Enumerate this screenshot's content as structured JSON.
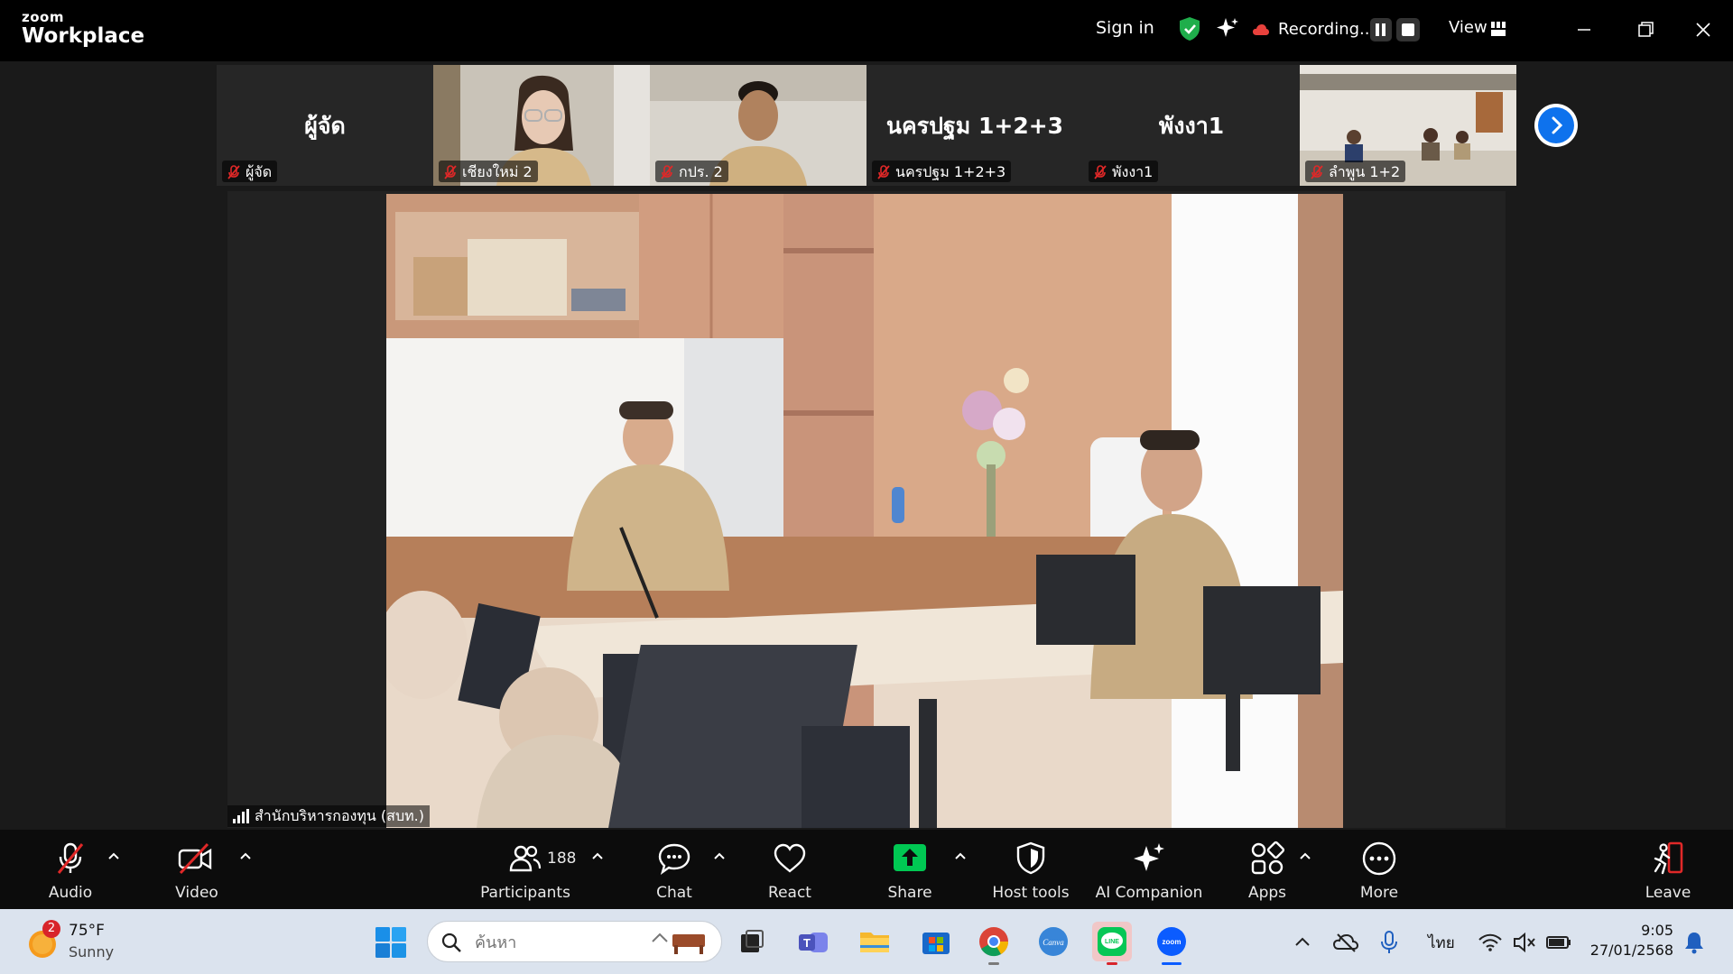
{
  "app": {
    "brand_small": "zoom",
    "brand_large": "Workplace"
  },
  "titlebar": {
    "sign_in": "Sign in",
    "recording_label": "Recording...",
    "view_label": "View"
  },
  "gallery": {
    "tiles": [
      {
        "big": "ผู้จัด",
        "label": "ผู้จัด"
      },
      {
        "big": "",
        "label": "เชียงใหม่ 2"
      },
      {
        "big": "",
        "label": "กปร. 2"
      },
      {
        "big": "นครปฐม 1+2+3",
        "label": "นครปฐม 1+2+3"
      },
      {
        "big": "พังงา1",
        "label": "พังงา1"
      },
      {
        "big": "",
        "label": "ลำพูน 1+2"
      }
    ]
  },
  "main_video": {
    "speaker": "สำนักบริหารกองทุน (สบท.)"
  },
  "toolbar": {
    "audio": "Audio",
    "video": "Video",
    "participants": "Participants",
    "participants_count": "188",
    "chat": "Chat",
    "react": "React",
    "share": "Share",
    "host_tools": "Host tools",
    "ai_companion": "AI Companion",
    "apps": "Apps",
    "more": "More",
    "leave": "Leave"
  },
  "taskbar": {
    "weather_badge": "2",
    "weather_temp": "75°F",
    "weather_desc": "Sunny",
    "search_placeholder": "ค้นหา",
    "language": "ไทย",
    "time": "9:05",
    "date": "27/01/2568"
  },
  "colors": {
    "zoom_blue": "#0e72ed",
    "share_green": "#00c853",
    "muted_red": "#e02828"
  }
}
